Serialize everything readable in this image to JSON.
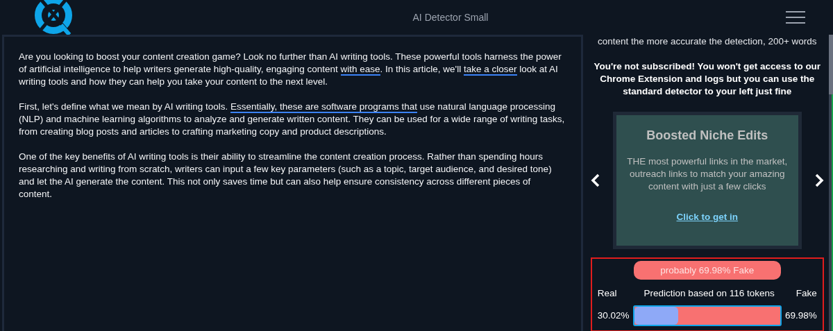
{
  "header": {
    "title": "AI Detector Small"
  },
  "editor": {
    "paragraphs": [
      [
        {
          "text": "Are you looking to boost your content creation game? Look no further than AI writing tools. These powerful tools harness the power of artificial intelligence to help writers generate high-quality, engaging content ",
          "underlined": false
        },
        {
          "text": "with ease",
          "underlined": true
        },
        {
          "text": ". In this article, we'll ",
          "underlined": false
        },
        {
          "text": "take a closer",
          "underlined": true
        },
        {
          "text": " look at AI writing tools and how they can help you take your content to the next level.",
          "underlined": false
        }
      ],
      [
        {
          "text": "First, let's define what we mean by AI writing tools. ",
          "underlined": false
        },
        {
          "text": "Essentially, these are software programs that",
          "underlined": true
        },
        {
          "text": " use natural language processing (NLP) and machine learning algorithms to analyze and generate written content. They can be used for a wide range of writing tasks, from creating blog posts and articles to crafting marketing copy and product descriptions.",
          "underlined": false
        }
      ],
      [
        {
          "text": "One of the key benefits of AI writing tools is their ability to streamline the content creation process. Rather than spending hours researching and writing from scratch, writers can input a few key parameters (such as a topic, target audience, and desired tone) and let the AI generate the content. This not only saves time but can also help ensure consistency across different pieces of content.",
          "underlined": false
        }
      ]
    ]
  },
  "sidebar": {
    "hint": "content the more accurate the detection, 200+ words",
    "notice": "You're not subscribed! You won't get access to our Chrome Extension and logs but you can use the standard detector to your left just fine",
    "ad": {
      "title": "Boosted Niche Edits",
      "body": "THE most powerful links in the market, outreach links to match your amazing content with just a few clicks",
      "link": "Click to get in"
    },
    "result": {
      "verdict": "probably 69.98% Fake",
      "real_label": "Real",
      "caption": "Prediction based on 116 tokens",
      "fake_label": "Fake",
      "real_value": "30.02%",
      "fake_value": "69.98%",
      "level": 0.3002
    }
  }
}
